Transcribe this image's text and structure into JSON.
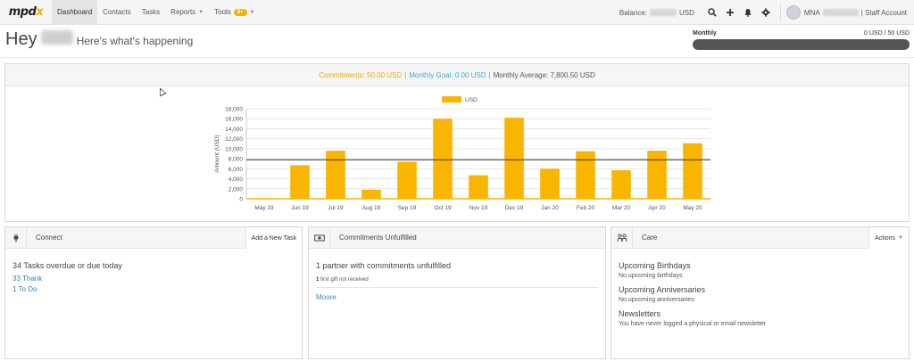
{
  "nav": {
    "logo_main": "mpd",
    "logo_x": "x",
    "items": [
      {
        "label": "Dashboard",
        "active": true
      },
      {
        "label": "Contacts"
      },
      {
        "label": "Tasks"
      },
      {
        "label": "Reports"
      },
      {
        "label": "Tools"
      }
    ],
    "tools_badge": "9+",
    "balance_label": "Balance:",
    "balance_currency": "USD",
    "account_initials": "MNA",
    "account_role": "| Staff Account"
  },
  "header": {
    "greeting": "Hey",
    "subtitle": "Here's what's happening",
    "goal_label": "Monthly",
    "goal_value": "0 USD / 50 USD"
  },
  "chart_panel": {
    "commitments": "Commitments: 50.00 USD",
    "monthly_goal": "Monthly Goal: 0.00 USD",
    "monthly_average": "Monthly Average: 7,800.50 USD",
    "sep1": "|",
    "sep2": "|"
  },
  "chart_data": {
    "type": "bar",
    "categories": [
      "May 19",
      "Jun 19",
      "Jul 19",
      "Aug 19",
      "Sep 19",
      "Oct 19",
      "Nov 19",
      "Dec 19",
      "Jan 20",
      "Feb 20",
      "Mar 20",
      "Apr 20",
      "May 20"
    ],
    "series": [
      {
        "name": "USD",
        "values": [
          100,
          6700,
          9600,
          1800,
          7400,
          16000,
          4700,
          16200,
          6000,
          9500,
          5700,
          9600,
          11100
        ]
      }
    ],
    "reference_line": 7800.5,
    "ylabel": "Amount (USD)",
    "ylim": [
      0,
      18000
    ],
    "yticks": [
      "0",
      "2,000",
      "4,000",
      "6,000",
      "8,000",
      "10,000",
      "12,000",
      "14,000",
      "16,000",
      "18,000"
    ],
    "tick_values": [
      0,
      2000,
      4000,
      6000,
      8000,
      10000,
      12000,
      14000,
      16000,
      18000
    ],
    "legend": "top-center",
    "grid": true,
    "bar_color": "#f9b500",
    "line_color": "#333333"
  },
  "connect": {
    "title": "Connect",
    "button": "Add a New Task",
    "summary": "34 Tasks overdue or due today",
    "links": [
      "33 Thank",
      "1 To Do"
    ]
  },
  "commitments": {
    "title": "Commitments Unfulfilled",
    "summary": "1 partner with commitments unfulfilled",
    "count": "1",
    "detail": " first gift not received",
    "link": "Moore"
  },
  "care": {
    "title": "Care",
    "button": "Actions",
    "birthdays_title": "Upcoming Birthdays",
    "birthdays_text": "No upcoming birthdays",
    "anniversaries_title": "Upcoming Anniversaries",
    "anniversaries_text": "No upcoming anniversaries",
    "newsletters_title": "Newsletters",
    "newsletters_text": "You have never logged a physical or email newsletter"
  }
}
